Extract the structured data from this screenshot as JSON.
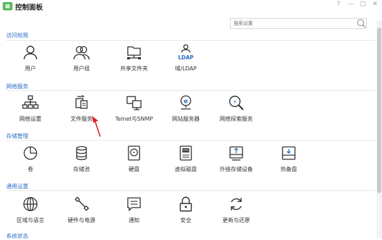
{
  "window": {
    "title": "控制面板",
    "help": "?",
    "minimize": "—",
    "maximize": "□",
    "close": "✕"
  },
  "search": {
    "placeholder": "搜索设置"
  },
  "sections": [
    {
      "title": "访问权限",
      "items": [
        {
          "label": "用户",
          "icon": "user-icon"
        },
        {
          "label": "用户组",
          "icon": "user-group-icon"
        },
        {
          "label": "共享文件夹",
          "icon": "shared-folder-icon"
        },
        {
          "label": "域/LDAP",
          "icon": "ldap-icon"
        }
      ]
    },
    {
      "title": "网络服务",
      "items": [
        {
          "label": "网络设置",
          "icon": "network-icon"
        },
        {
          "label": "文件服务",
          "icon": "file-service-icon"
        },
        {
          "label": "Telnet与SNMP",
          "icon": "telnet-icon"
        },
        {
          "label": "网站服务器",
          "icon": "web-server-icon"
        },
        {
          "label": "网络探索服务",
          "icon": "network-discovery-icon"
        }
      ]
    },
    {
      "title": "存储管理",
      "items": [
        {
          "label": "卷",
          "icon": "volume-icon"
        },
        {
          "label": "存储池",
          "icon": "storage-pool-icon"
        },
        {
          "label": "硬盘",
          "icon": "hard-disk-icon"
        },
        {
          "label": "虚拟磁盘",
          "icon": "virtual-disk-icon"
        },
        {
          "label": "外接存储设备",
          "icon": "external-storage-icon"
        },
        {
          "label": "热备盘",
          "icon": "hot-spare-icon"
        }
      ]
    },
    {
      "title": "通用设置",
      "items": [
        {
          "label": "区域与语言",
          "icon": "globe-icon"
        },
        {
          "label": "硬件与电源",
          "icon": "wrench-icon"
        },
        {
          "label": "通知",
          "icon": "notification-icon"
        },
        {
          "label": "安全",
          "icon": "lock-icon"
        },
        {
          "label": "更新与还原",
          "icon": "update-icon"
        }
      ]
    }
  ],
  "next_section_title": "系统状态",
  "colors": {
    "accent": "#2a6fc2",
    "icon_stroke": "#2b2b2b",
    "arrow": "#e02020",
    "app_icon": "#5cb85c"
  }
}
